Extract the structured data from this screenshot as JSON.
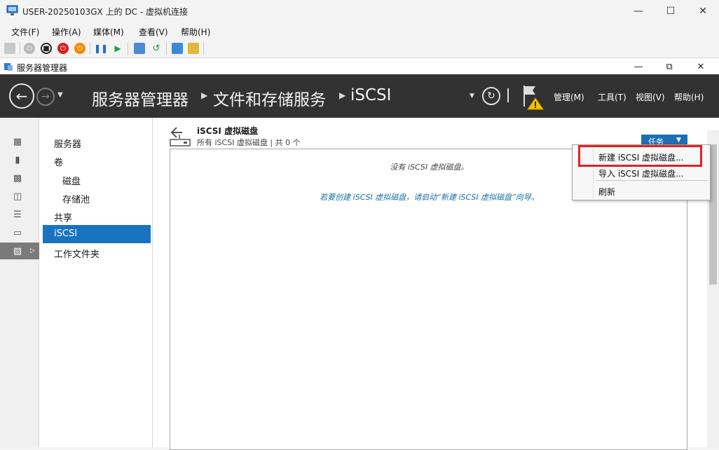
{
  "vm_window": {
    "title": "USER-20250103GX 上的 DC - 虚拟机连接",
    "menu": [
      "文件(F)",
      "操作(A)",
      "媒体(M)",
      "查看(V)",
      "帮助(H)"
    ]
  },
  "sm_window": {
    "title": "服务器管理器"
  },
  "header": {
    "breadcrumb": [
      "服务器管理器",
      "文件和存储服务",
      "iSCSI"
    ],
    "menus": [
      "管理(M)",
      "工具(T)",
      "视图(V)",
      "帮助(H)"
    ]
  },
  "nav": {
    "items": [
      {
        "label": "服务器",
        "level": 0
      },
      {
        "label": "卷",
        "level": 0
      },
      {
        "label": "磁盘",
        "level": 1
      },
      {
        "label": "存储池",
        "level": 1
      },
      {
        "label": "共享",
        "level": 0
      },
      {
        "label": "iSCSI",
        "level": 0,
        "selected": true
      },
      {
        "label": "工作文件夹",
        "level": 0
      }
    ]
  },
  "tile": {
    "title": "iSCSI 虚拟磁盘",
    "subtitle": "所有 iSCSI 虚拟磁盘 | 共 0 个",
    "tasks_label": "任务",
    "empty_message": "没有 iSCSI 虚拟磁盘。",
    "hint_message": "若要创建 iSCSI 虚拟磁盘，请启动“新建 iSCSI 虚拟磁盘”向导。"
  },
  "context_menu": {
    "items": [
      "新建 iSCSI 虚拟磁盘...",
      "导入 iSCSI 虚拟磁盘...",
      "刷新"
    ]
  },
  "colors": {
    "header_bg": "#323232",
    "accent": "#1a73c1",
    "highlight": "#e52222",
    "warning": "#f5c400"
  }
}
